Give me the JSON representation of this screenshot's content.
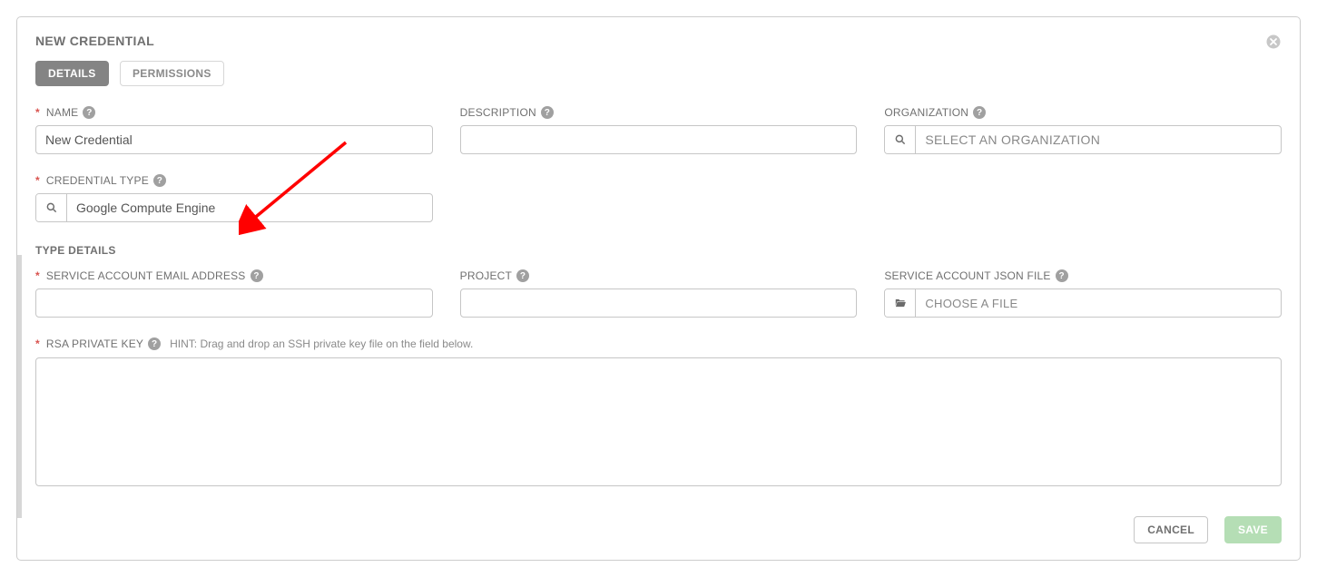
{
  "panel": {
    "title": "NEW CREDENTIAL"
  },
  "tabs": {
    "details": "DETAILS",
    "permissions": "PERMISSIONS"
  },
  "fields": {
    "name": {
      "label": "NAME",
      "value": "New Credential",
      "required": true
    },
    "description": {
      "label": "DESCRIPTION",
      "value": "",
      "required": false
    },
    "organization": {
      "label": "ORGANIZATION",
      "placeholder": "SELECT AN ORGANIZATION",
      "value": "",
      "required": false
    },
    "credential_type": {
      "label": "CREDENTIAL TYPE",
      "value": "Google Compute Engine",
      "required": true
    }
  },
  "type_details": {
    "header": "TYPE DETAILS",
    "service_account_email": {
      "label": "SERVICE ACCOUNT EMAIL ADDRESS",
      "value": "",
      "required": true
    },
    "project": {
      "label": "PROJECT",
      "value": "",
      "required": false
    },
    "json_file": {
      "label": "SERVICE ACCOUNT JSON FILE",
      "placeholder": "CHOOSE A FILE",
      "required": false
    },
    "rsa_key": {
      "label": "RSA PRIVATE KEY",
      "hint": "HINT: Drag and drop an SSH private key file on the field below.",
      "value": "",
      "required": true
    }
  },
  "buttons": {
    "cancel": "CANCEL",
    "save": "SAVE"
  },
  "colors": {
    "required": "#d9534f",
    "save_green": "#5cb85c",
    "arrow_red": "#ff0000"
  }
}
